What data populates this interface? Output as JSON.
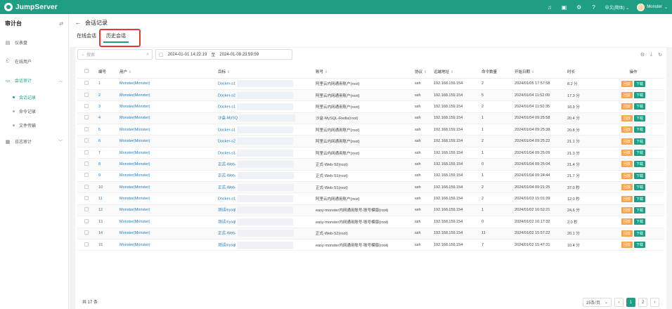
{
  "app": {
    "name": "JumpServer"
  },
  "topbar": {
    "lang": "中文(简体)",
    "user": "Monster"
  },
  "sidebar": {
    "title": "审计台",
    "items": [
      {
        "label": "仪表盘",
        "icon": "dashboard-icon"
      },
      {
        "label": "在线用户",
        "icon": "users-icon"
      },
      {
        "label": "会话审计",
        "icon": "monitor-icon"
      },
      {
        "label": "日志审计",
        "icon": "log-icon"
      }
    ],
    "sub_items": [
      "会话记录",
      "命令记录",
      "文件传输"
    ]
  },
  "page": {
    "title": "会话记录",
    "tabs": [
      "在线会话",
      "历史会话"
    ]
  },
  "toolbar": {
    "search_placeholder": "搜索",
    "date_start": "2024-01-01 14:22:19",
    "date_sep": "至",
    "date_end": "2024-01-08 23:59:59"
  },
  "table": {
    "headers": [
      "编号",
      "用户",
      "目标",
      "账号",
      "协议",
      "远端地址",
      "命令数量",
      "开始日期",
      "时长",
      "操作"
    ],
    "action_replay": "回放",
    "action_download": "下载",
    "rows": [
      {
        "id": "1",
        "user": "Monster(Monster)",
        "target": "Docker-s1",
        "account": "阿里云内网通用账户(root)",
        "proto": "ssh",
        "addr": "192.168.159.154",
        "cmds": "2",
        "start": "2024/01/05 17:57:58",
        "dur": "8.2 分"
      },
      {
        "id": "2",
        "user": "Monster(Monster)",
        "target": "Docker-s2",
        "account": "阿里云内网通用账户(root)",
        "proto": "ssh",
        "addr": "192.168.159.154",
        "cmds": "5",
        "start": "2024/01/04 11:52:09",
        "dur": "17.3 分"
      },
      {
        "id": "3",
        "user": "Monster(Monster)",
        "target": "Docker-s1",
        "account": "阿里云内网通用账户(root)",
        "proto": "ssh",
        "addr": "192.168.159.154",
        "cmds": "2",
        "start": "2024/01/04 11:50:35",
        "dur": "18.9 分"
      },
      {
        "id": "4",
        "user": "Monster(Monster)",
        "target": "沙盒-MySQ",
        "account": "沙盒-MySQL-Redis(root)",
        "proto": "ssh",
        "addr": "192.168.159.154",
        "cmds": "1",
        "start": "2024/01/04 09:25:58",
        "dur": "20.4 分"
      },
      {
        "id": "5",
        "user": "Monster(Monster)",
        "target": "Docker-s1",
        "account": "阿里云内网通用账户(root)",
        "proto": "ssh",
        "addr": "192.168.159.154",
        "cmds": "1",
        "start": "2024/01/04 09:25:38",
        "dur": "20.8 分"
      },
      {
        "id": "6",
        "user": "Monster(Monster)",
        "target": "Docker-s2",
        "account": "阿里云内网通用账户(root)",
        "proto": "ssh",
        "addr": "192.168.159.154",
        "cmds": "2",
        "start": "2024/01/04 09:25:22",
        "dur": "21.1 分"
      },
      {
        "id": "7",
        "user": "Monster(Monster)",
        "target": "Docker-s1",
        "account": "阿里云内网通用账户(root)",
        "proto": "ssh",
        "addr": "192.168.159.154",
        "cmds": "1",
        "start": "2024/01/04 09:25:09",
        "dur": "21.3 分"
      },
      {
        "id": "8",
        "user": "Monster(Monster)",
        "target": "正式-Web-",
        "account": "正式-Web-S2(root)",
        "proto": "ssh",
        "addr": "192.168.159.154",
        "cmds": "0",
        "start": "2024/01/04 09:25:04",
        "dur": "21.4 分"
      },
      {
        "id": "9",
        "user": "Monster(Monster)",
        "target": "正式-Web-",
        "account": "正式-Web-S1(root)",
        "proto": "ssh",
        "addr": "192.168.159.154",
        "cmds": "1",
        "start": "2024/01/04 09:24:44",
        "dur": "21.7 分"
      },
      {
        "id": "10",
        "user": "Monster(Monster)",
        "target": "正式-Web-",
        "account": "正式-Web-S1(root)",
        "proto": "ssh",
        "addr": "192.168.159.154",
        "cmds": "2",
        "start": "2024/01/04 09:21:25",
        "dur": "37.0 秒"
      },
      {
        "id": "11",
        "user": "Monster(Monster)",
        "target": "Docker-s1",
        "account": "阿里云内网通用账户(root)",
        "proto": "ssh",
        "addr": "192.168.159.154",
        "cmds": "2",
        "start": "2024/01/03 15:01:39",
        "dur": "12.0 秒"
      },
      {
        "id": "12",
        "user": "Monster(Monster)",
        "target": "测试mysql",
        "account": "easy-monster内网通用账号-账号模版(root)",
        "proto": "ssh",
        "addr": "192.168.159.154",
        "cmds": "1",
        "start": "2024/01/02 16:52:21",
        "dur": "24.6 分"
      },
      {
        "id": "13",
        "user": "Monster(Monster)",
        "target": "测试mysql",
        "account": "easy-monster内网通用账号-账号模版(root)",
        "proto": "ssh",
        "addr": "192.168.159.154",
        "cmds": "0",
        "start": "2024/01/02 16:17:32",
        "dur": "2.0 秒"
      },
      {
        "id": "14",
        "user": "Monster(Monster)",
        "target": "正式-Web-",
        "account": "正式-Web-S2(root)",
        "proto": "ssh",
        "addr": "192.168.159.154",
        "cmds": "11",
        "start": "2024/01/02 15:57:22",
        "dur": "20.1 分"
      },
      {
        "id": "15",
        "user": "Monster(Monster)",
        "target": "测试mysql",
        "account": "easy-monster内网通用账号-账号模版(root)",
        "proto": "ssh",
        "addr": "192.168.159.154",
        "cmds": "7",
        "start": "2024/01/02 15:47:31",
        "dur": "10.4 分"
      }
    ]
  },
  "footer": {
    "total": "共 17 条",
    "page_size": "15条/页",
    "pages": [
      "1",
      "2"
    ],
    "current_page": "1"
  },
  "colors": {
    "brand": "#1f9e84",
    "replay": "#f5a44c",
    "link": "#1f7ab8",
    "highlight": "#e53935"
  }
}
